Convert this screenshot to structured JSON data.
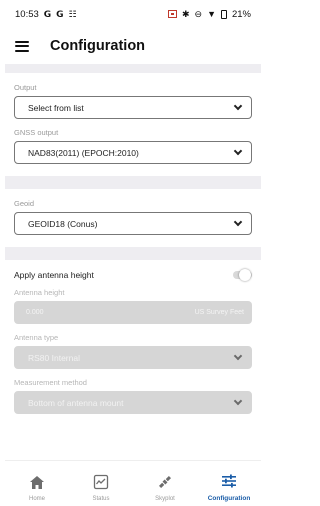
{
  "status_bar": {
    "time": "10:53",
    "battery": "21%"
  },
  "app_bar": {
    "title": "Configuration"
  },
  "output_section": {
    "output_label": "Output",
    "output_value": "Select from list",
    "gnss_label": "GNSS output",
    "gnss_value": "NAD83(2011) (EPOCH:2010)"
  },
  "geoid_section": {
    "label": "Geoid",
    "value": "GEOID18 (Conus)"
  },
  "antenna_section": {
    "toggle_label": "Apply antenna height",
    "toggle_on": false,
    "height_label": "Antenna height",
    "height_value": "0.000",
    "height_unit": "US Survey Feet",
    "type_label": "Antenna type",
    "type_value": "RS80 Internal",
    "method_label": "Measurement method",
    "method_value": "Bottom of antenna mount"
  },
  "bottom_nav": {
    "items": [
      {
        "label": "Home",
        "icon": "home-icon"
      },
      {
        "label": "Status",
        "icon": "status-icon"
      },
      {
        "label": "Skyplot",
        "icon": "satellite-icon"
      },
      {
        "label": "Configuration",
        "icon": "sliders-icon"
      }
    ],
    "active_index": 3
  },
  "colors": {
    "accent": "#1b5da8",
    "section_gap": "#eeedf1",
    "disabled_fill": "#d6d6d6"
  }
}
